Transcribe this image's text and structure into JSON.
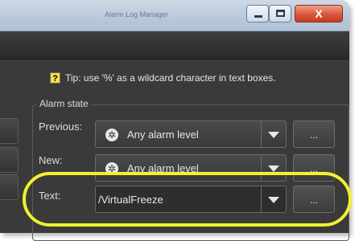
{
  "window": {
    "title": "Alarm Log Manager",
    "controls": {
      "minimize_icon": "minimize-icon",
      "maximize_icon": "maximize-icon",
      "close_label": "X"
    }
  },
  "tip": {
    "icon_label": "?",
    "text": "Tip: use '%' as a wildcard character in text boxes."
  },
  "alarm_state": {
    "group_label": "Alarm state",
    "previous": {
      "label": "Previous:",
      "value": "Any alarm level",
      "browse_label": "..."
    },
    "new": {
      "label": "New:",
      "value": "Any alarm level",
      "browse_label": "..."
    },
    "text": {
      "label": "Text:",
      "value": "/VirtualFreeze",
      "browse_label": "..."
    }
  },
  "colors": {
    "highlight": "#f1f22c",
    "panel_bg": "#3a3a3a",
    "titlebar": "#b8c8dc"
  }
}
